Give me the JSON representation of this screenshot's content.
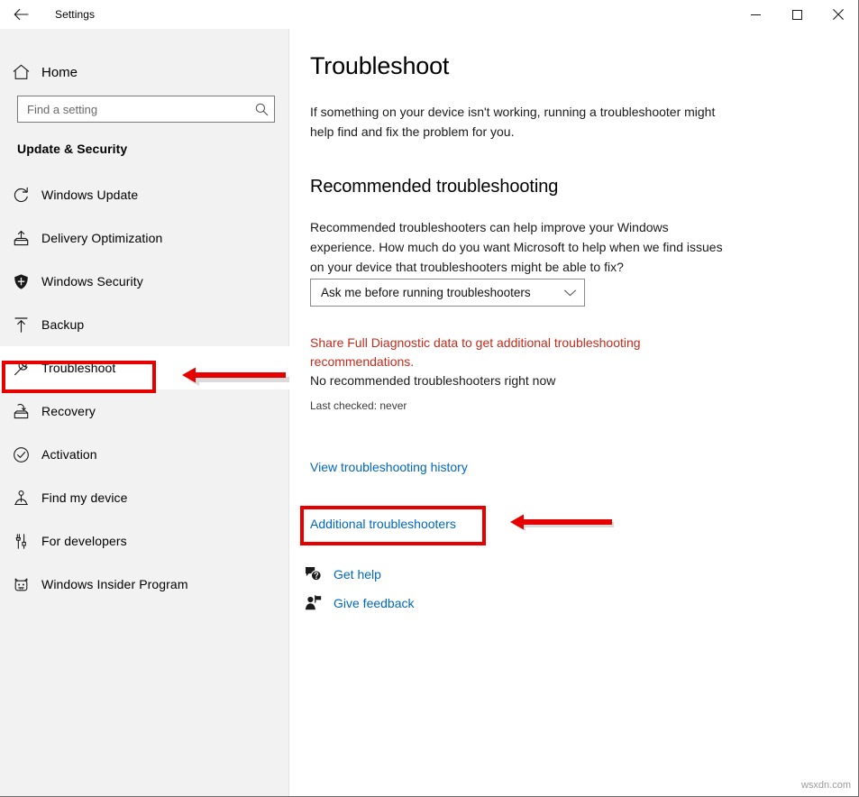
{
  "window": {
    "app_title": "Settings",
    "back_icon": "back-arrow-icon",
    "controls": {
      "minimize_label": "–",
      "maximize_label": "□",
      "close_label": "✕"
    }
  },
  "sidebar": {
    "home": {
      "label": "Home",
      "icon": "home-icon"
    },
    "search": {
      "value": "",
      "placeholder": "Find a setting",
      "icon": "search-icon"
    },
    "category_title": "Update & Security",
    "items": [
      {
        "label": "Windows Update",
        "icon": "refresh-icon",
        "selected": false
      },
      {
        "label": "Delivery Optimization",
        "icon": "upload-box-icon",
        "selected": false
      },
      {
        "label": "Windows Security",
        "icon": "shield-icon",
        "selected": false
      },
      {
        "label": "Backup",
        "icon": "upload-arrow-icon",
        "selected": false
      },
      {
        "label": "Troubleshoot",
        "icon": "wrench-icon",
        "selected": true
      },
      {
        "label": "Recovery",
        "icon": "recovery-icon",
        "selected": false
      },
      {
        "label": "Activation",
        "icon": "check-circle-icon",
        "selected": false
      },
      {
        "label": "Find my device",
        "icon": "person-locate-icon",
        "selected": false
      },
      {
        "label": "For developers",
        "icon": "tools-icon",
        "selected": false
      },
      {
        "label": "Windows Insider Program",
        "icon": "insider-bug-icon",
        "selected": false
      }
    ]
  },
  "main": {
    "page_title": "Troubleshoot",
    "page_description": "If something on your device isn't working, running a troubleshooter might help find and fix the problem for you.",
    "section_heading": "Recommended troubleshooting",
    "section_description": "Recommended troubleshooters can help improve your Windows experience. How much do you want Microsoft to help when we find issues on your device that troubleshooters might be able to fix?",
    "recommendation_dropdown": {
      "selected": "Ask me before running troubleshooters",
      "chevron_icon": "chevron-down-icon",
      "options": [
        "Ask me before running troubleshooters"
      ]
    },
    "diagnostic_warning": "Share Full Diagnostic data to get additional troubleshooting recommendations.",
    "no_recommendations": "No recommended troubleshooters right now",
    "last_checked": "Last checked: never",
    "links": {
      "history": "View troubleshooting history",
      "additional": "Additional troubleshooters",
      "get_help": {
        "label": "Get help",
        "icon": "help-bubble-icon"
      },
      "give_feedback": {
        "label": "Give feedback",
        "icon": "feedback-person-icon"
      }
    }
  },
  "annotations": {
    "highlight_color": "#e60000",
    "boxes": [
      {
        "target": "Troubleshoot"
      },
      {
        "target": "Additional troubleshooters"
      }
    ],
    "arrows": [
      {
        "points_to": "Troubleshoot",
        "direction": "left"
      },
      {
        "points_to": "Additional troubleshooters",
        "direction": "left"
      }
    ]
  },
  "watermark": "wsxdn.com"
}
